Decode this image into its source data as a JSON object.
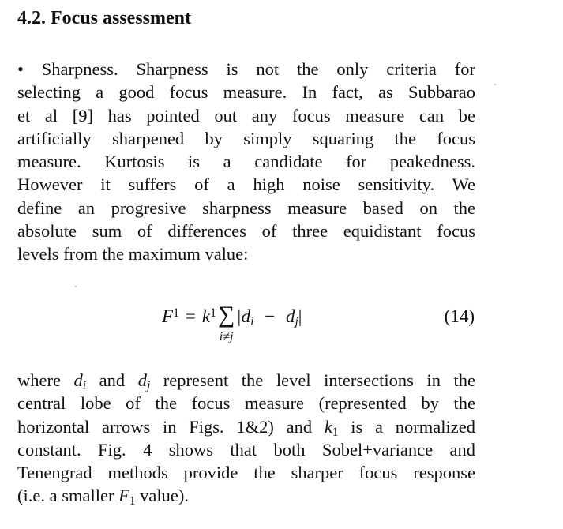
{
  "section": {
    "heading": "4.2. Focus assessment"
  },
  "paragraph1": {
    "lines": [
      "• Sharpness. Sharpness is not the only criteria for",
      "selecting a good focus measure. In fact, as Subbarao",
      "et al [9] has pointed out any focus measure can be",
      "artificially sharpened by simply squaring the focus",
      "measure. Kurtosis is a candidate for peakedness.",
      "However it suffers of a high noise sensitivity. We",
      "define an progresive sharpness measure based on the",
      "absolute sum of differences of three equidistant focus",
      "levels from the maximum value:"
    ]
  },
  "equation": {
    "lhs": "F",
    "lhs_sub": "1",
    "equals": "=",
    "coef": "k",
    "coef_sub": "1",
    "sum_symbol": "∑",
    "sum_index": "i≠j",
    "body": "|d",
    "body_sub_i": "i",
    "minus": "−",
    "body2": "d",
    "body_sub_j": "j",
    "close": "|",
    "number": "(14)"
  },
  "paragraph2": {
    "line1_a": "where ",
    "line1_var_d1": "d",
    "line1_sub_i": "i",
    "line1_b": " and ",
    "line1_var_d2": "d",
    "line1_sub_j": "j",
    "line1_c": " represent the level intersections in the",
    "line2": "central lobe of the focus measure (represented by the",
    "line3_a": "horizontal arrows in Figs. 1&2) and ",
    "line3_var": "k",
    "line3_sub": "1",
    "line3_b": " is a normalized",
    "line4": "constant. Fig. 4 shows that both Sobel+variance and",
    "line5": "Tenengrad methods provide the sharper focus response",
    "line6_a": "(i.e. a smaller ",
    "line6_var": "F",
    "line6_sub": "1",
    "line6_b": " value)."
  }
}
